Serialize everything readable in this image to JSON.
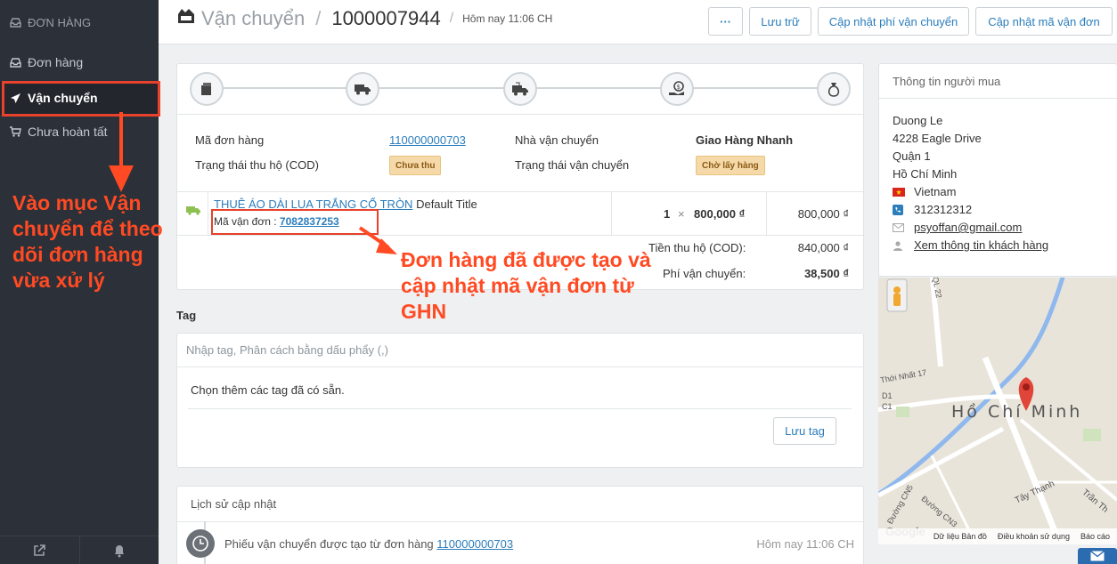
{
  "sidebar": {
    "heading": "ĐƠN HÀNG",
    "items": [
      {
        "label": "Đơn hàng"
      },
      {
        "label": "Vận chuyển"
      },
      {
        "label": "Chưa hoàn tất"
      }
    ],
    "annotation": "Vào mục Vận chuyển để theo dõi đơn hàng vừa xử lý"
  },
  "header": {
    "section": "Vận chuyển",
    "order_number": "1000007944",
    "time": "Hôm nay 11:06 CH",
    "buttons": {
      "more": "···",
      "archive": "Lưu trữ",
      "update_fee": "Cập nhật phí vận chuyển",
      "update_code": "Cập nhật mã vận đơn"
    }
  },
  "shipment": {
    "order_label": "Mã đơn hàng",
    "order_value": "110000000703",
    "carrier_label": "Nhà vận chuyển",
    "carrier_value": "Giao Hàng Nhanh",
    "cod_status_label": "Trạng thái thu hộ (COD)",
    "cod_status_badge": "Chưa thu",
    "ship_status_label": "Trạng thái vận chuyển",
    "ship_status_badge": "Chờ lấy hàng",
    "product_name": "THUÊ ÁO DÀI LỤA TRẮNG CỔ TRÒN",
    "product_variant": "Default Title",
    "tracking_label": "Mã vận đơn :",
    "tracking_code": "7082837253",
    "qty": "1",
    "times": "×",
    "unit_price": "800,000 ₫",
    "line_total": "800,000 ₫",
    "cod_label": "Tiền thu hộ (COD):",
    "cod_value": "840,000 ₫",
    "fee_label": "Phí vận chuyển:",
    "fee_value": "38,500 ₫",
    "annotation": "Đơn hàng đã được tạo và cập nhật mã vận đơn từ GHN"
  },
  "tags": {
    "title": "Tag",
    "placeholder": "Nhập tag, Phân cách bằng dấu phẩy (,)",
    "choose_text": "Chọn thêm các tag đã có sẵn.",
    "save_button": "Lưu tag"
  },
  "history": {
    "title": "Lịch sử cập nhật",
    "entry_text": "Phiếu vận chuyển được tạo từ đơn hàng",
    "entry_link": "110000000703",
    "entry_time": "Hôm nay 11:06 CH"
  },
  "buyer": {
    "title": "Thông tin người mua",
    "name": "Duong Le",
    "address": "4228 Eagle Drive",
    "district": "Quận 1",
    "city": "Hồ Chí Minh",
    "country": "Vietnam",
    "phone": "312312312",
    "email": "psyoffan@gmail.com",
    "view_customer": "Xem thông tin khách hàng"
  },
  "map": {
    "city_label": "Hồ Chí Minh",
    "street_labels": [
      "Thới Nhất 17",
      "D1",
      "C1",
      "Đường CN5",
      "Đường CN3",
      "Tây Thạnh",
      "Trần Th",
      "QL 22"
    ],
    "logo": "Google",
    "footer": [
      "Dữ liệu Bản đồ",
      "Điều khoản sử dụng",
      "Báo cáo"
    ]
  },
  "colors": {
    "accent": "#2b7dbc",
    "annotation": "#ff4a23",
    "sidebar_bg": "#2c3038"
  }
}
